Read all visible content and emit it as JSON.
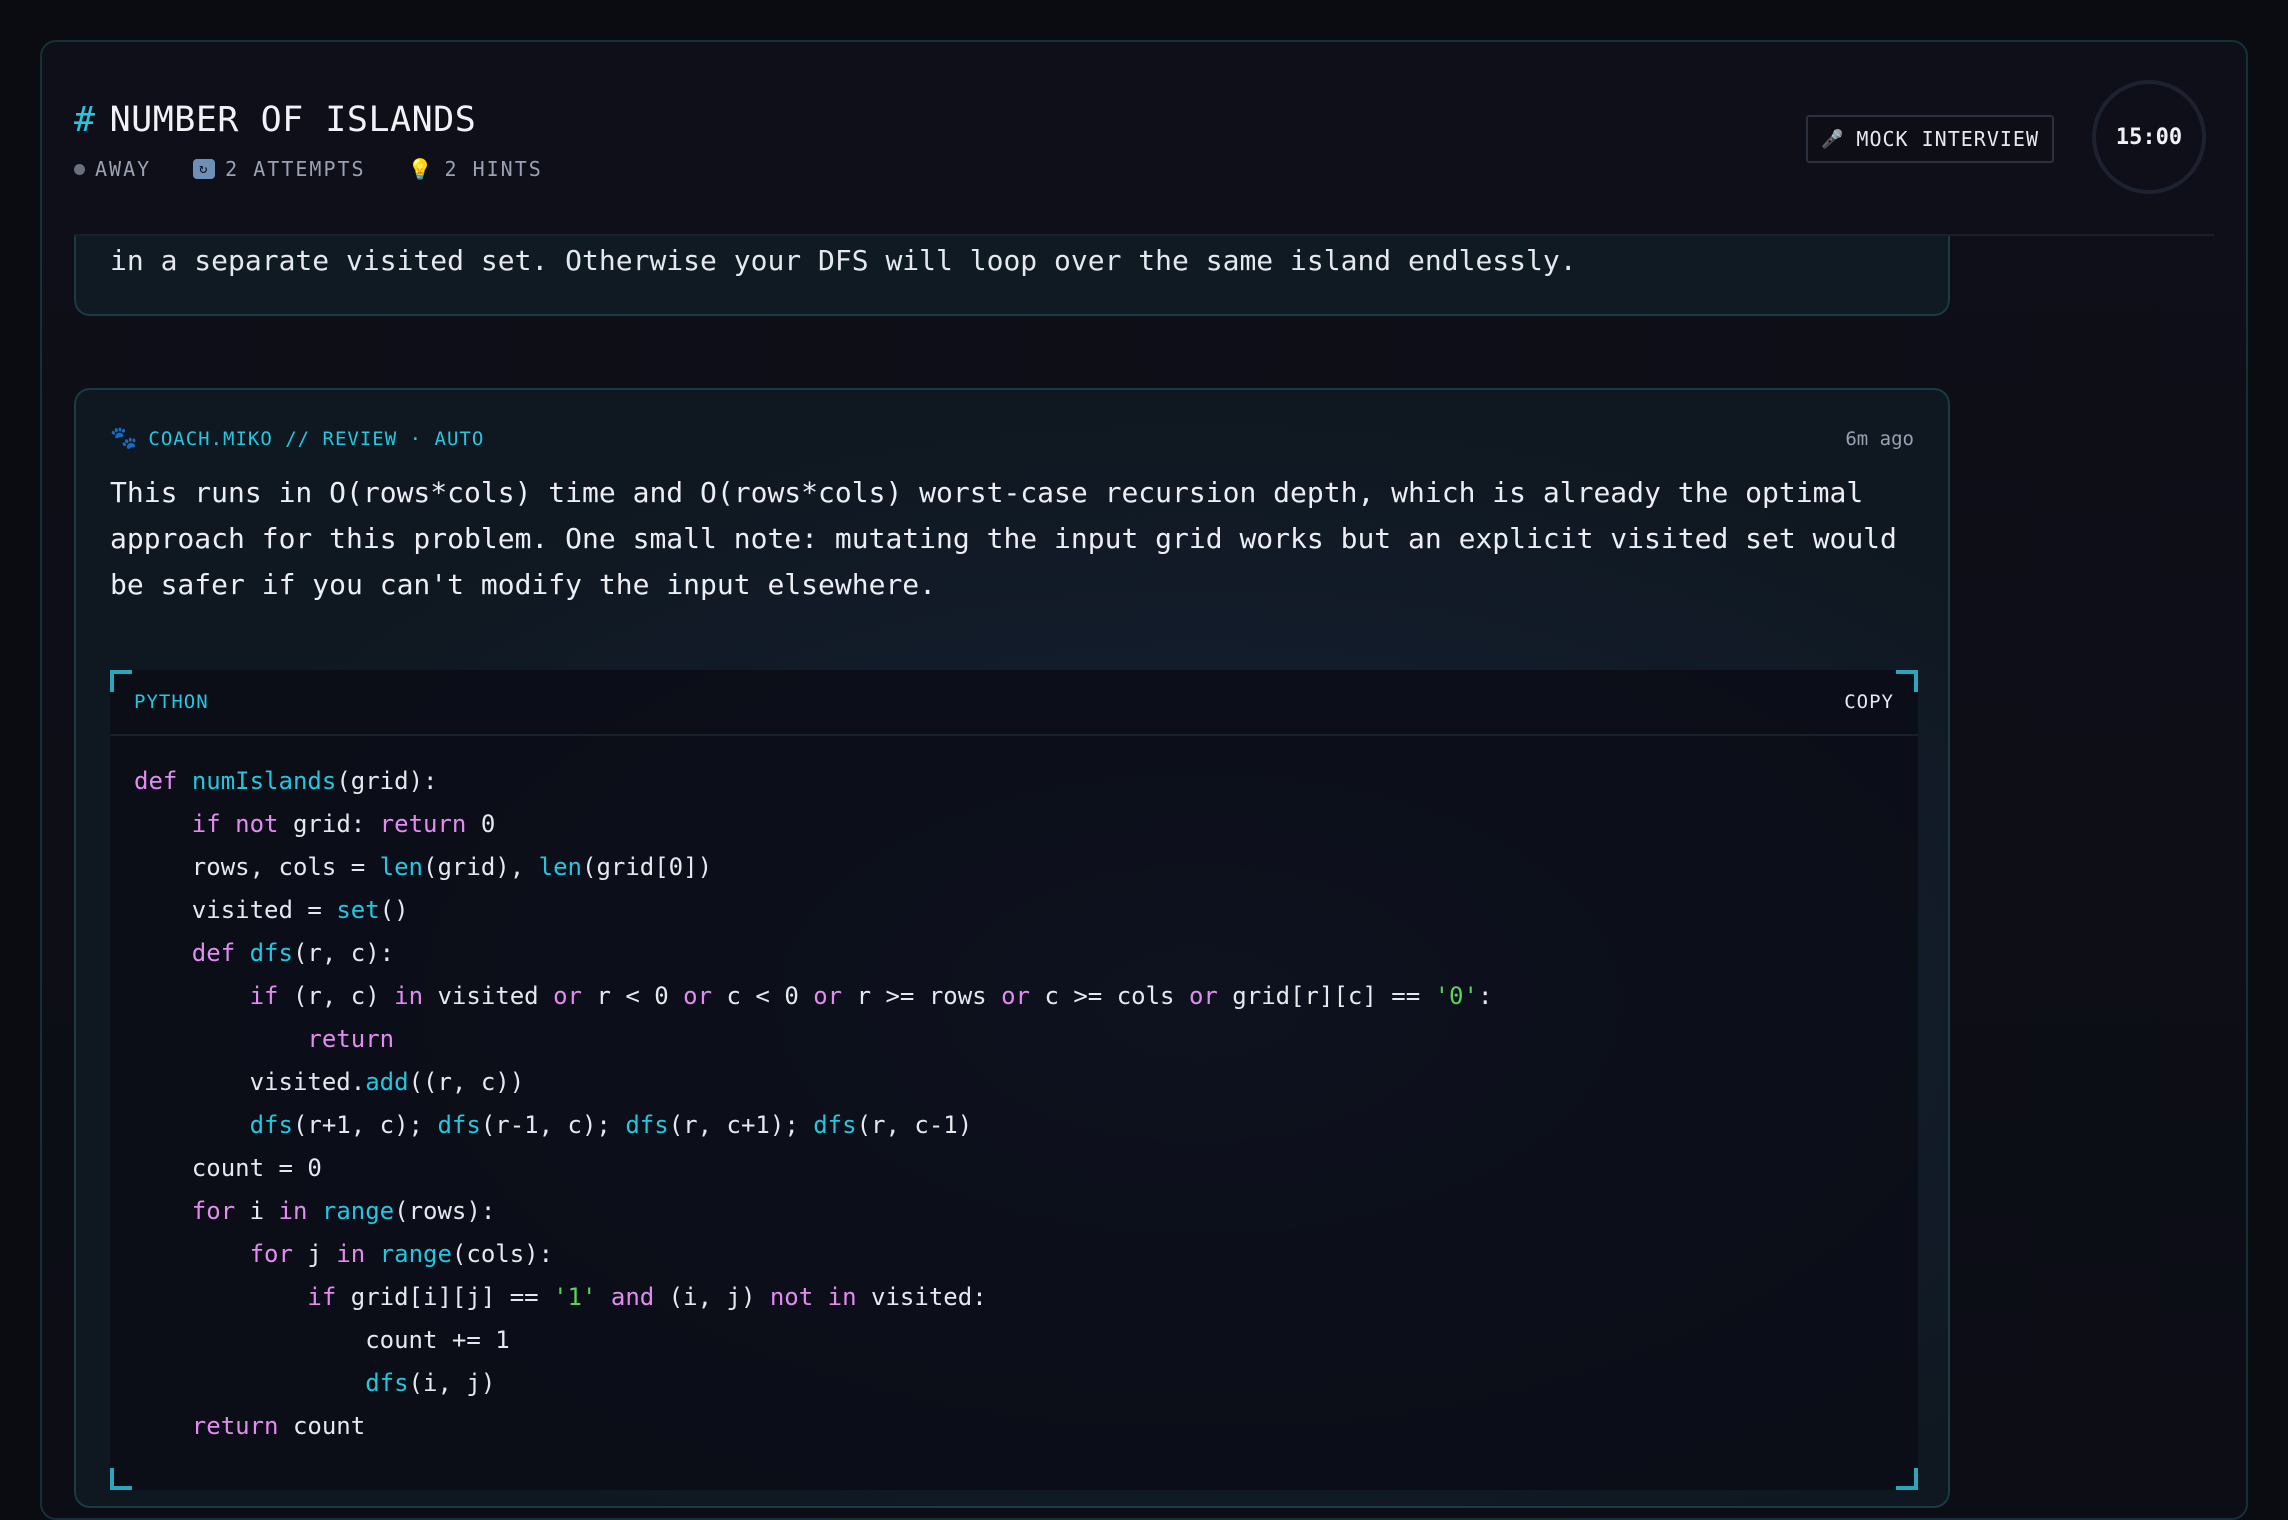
{
  "header": {
    "hash": "#",
    "title": "NUMBER OF ISLANDS",
    "status": "AWAY",
    "attempts": "2 ATTEMPTS",
    "hints": "2 HINTS",
    "mock_label": "MOCK INTERVIEW",
    "timer": "15:00"
  },
  "previous_message": {
    "text_tail": "in a separate visited set. Otherwise your DFS will loop over the same island endlessly."
  },
  "message": {
    "author": "COACH.MIKO // REVIEW · AUTO",
    "time": "6m ago",
    "body": "This runs in O(rows*cols) time and O(rows*cols) worst-case recursion depth, which is already the optimal approach for this problem. One small note: mutating the input grid works but an explicit visited set would be safer if you can't modify the input elsewhere.",
    "code": {
      "language": "PYTHON",
      "copy_label": "COPY",
      "lines": [
        "def numIslands(grid):",
        "    if not grid: return 0",
        "    rows, cols = len(grid), len(grid[0])",
        "    visited = set()",
        "    def dfs(r, c):",
        "        if (r, c) in visited or r < 0 or c < 0 or r >= rows or c >= cols or grid[r][c] == '0':",
        "            return",
        "        visited.add((r, c))",
        "        dfs(r+1, c); dfs(r-1, c); dfs(r, c+1); dfs(r, c-1)",
        "    count = 0",
        "    for i in range(rows):",
        "        for j in range(cols):",
        "            if grid[i][j] == '1' and (i, j) not in visited:",
        "                count += 1",
        "                dfs(i, j)",
        "    return count"
      ]
    }
  },
  "icons": {
    "status": "status-dot-icon",
    "attempts": "retry-icon",
    "hints": "bulb-icon",
    "mock": "microphone-icon",
    "author": "paw-icon"
  },
  "colors": {
    "accent": "#22c7e0",
    "keyword": "#e38bf0",
    "string": "#5ad35a"
  }
}
